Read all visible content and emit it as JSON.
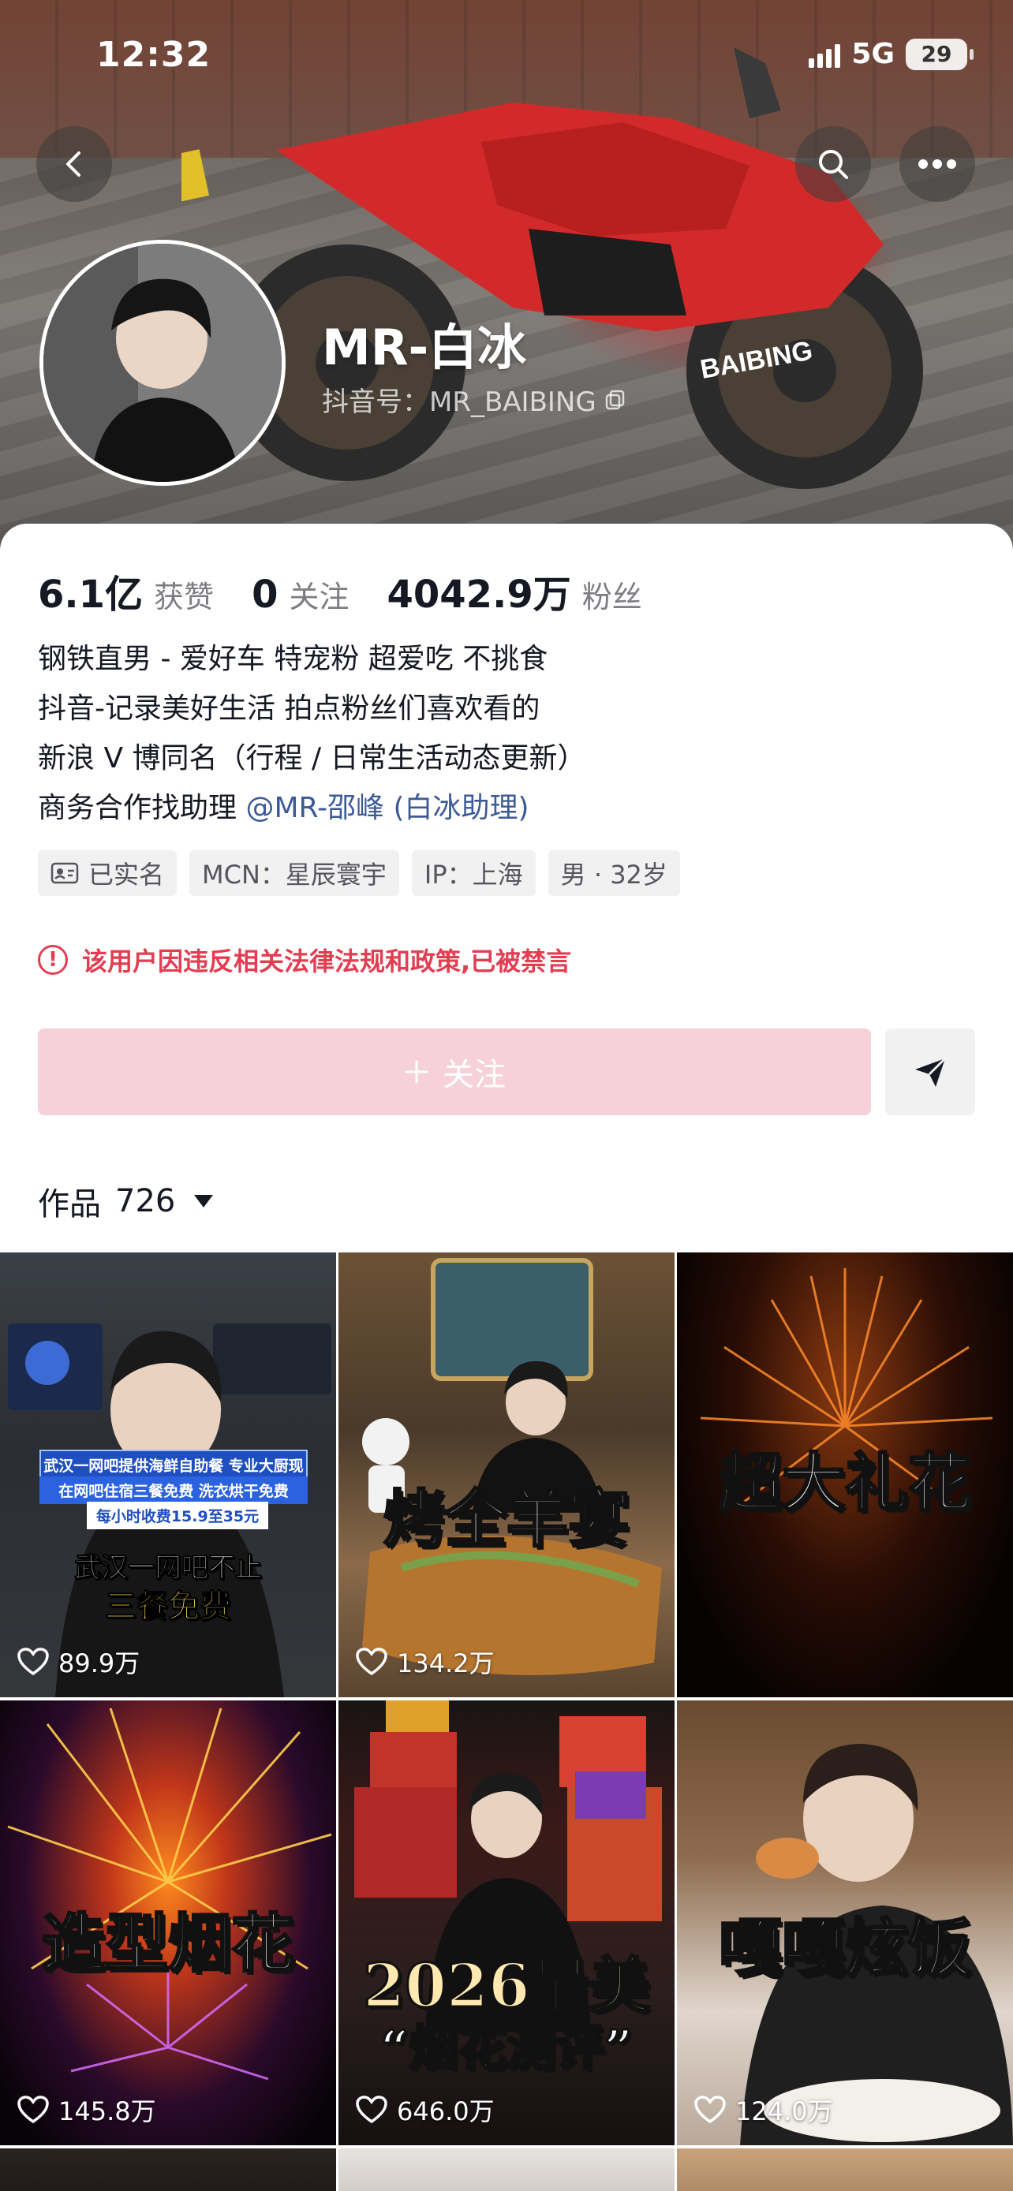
{
  "status_bar": {
    "time": "12:32",
    "network": "5G",
    "battery": "29"
  },
  "profile": {
    "name": "MR-白冰",
    "douyin_id": "抖音号：MR_BAIBING",
    "stats": [
      {
        "value": "6.1亿",
        "label": "获赞"
      },
      {
        "value": "0",
        "label": "关注"
      },
      {
        "value": "4042.9万",
        "label": "粉丝"
      }
    ],
    "bio": {
      "line1": "钢铁直男 - 爱好车 特宠粉 超爱吃 不挑食",
      "line2": "抖音-记录美好生活 拍点粉丝们喜欢看的",
      "line3": "新浪 V 博同名（行程 / 日常生活动态更新）",
      "line4_prefix": "商务合作找助理 ",
      "line4_mention": "@MR-邵峰 (白冰助理)"
    },
    "tags": {
      "verified": "已实名",
      "mcn": "MCN：星辰寰宇",
      "ip": "IP：上海",
      "gender_age": "男 · 32岁"
    },
    "ban_notice": "该用户因违反相关法律法规和政策,已被禁言",
    "follow_button": "关注",
    "works_label": "作品",
    "works_count": "726"
  },
  "videos": [
    {
      "likes": "89.9万",
      "caption": ""
    },
    {
      "likes": "134.2万",
      "caption": "烤全羊宴"
    },
    {
      "likes": "",
      "caption": "超大礼花"
    },
    {
      "likes": "145.8万",
      "caption": "造型烟花"
    },
    {
      "likes": "646.0万",
      "caption": "2026最美"
    },
    {
      "likes": "124.0万",
      "caption": "嘎嘎炫饭"
    }
  ],
  "video1_overlay": {
    "banner1": "武汉一网吧提供海鲜自助餐 专业大厨现做",
    "banner2": "在网吧住宿三餐免费 洗衣烘干免费",
    "banner3": "每小时收费15.9至35元",
    "text1": "武汉一网吧不止",
    "text2": "三餐免费"
  },
  "video5_overlay": {
    "subtitle": "“烟花测评”"
  },
  "colors": {
    "accent_red": "#e33d52",
    "follow_pink": "#f6d1d9",
    "mention_blue": "#3c5a96"
  },
  "icons": [
    "back-icon",
    "search-icon",
    "more-icon",
    "copy-icon",
    "id-card-icon",
    "warning-icon",
    "plus-icon",
    "share-icon",
    "dropdown-icon",
    "heart-icon"
  ]
}
